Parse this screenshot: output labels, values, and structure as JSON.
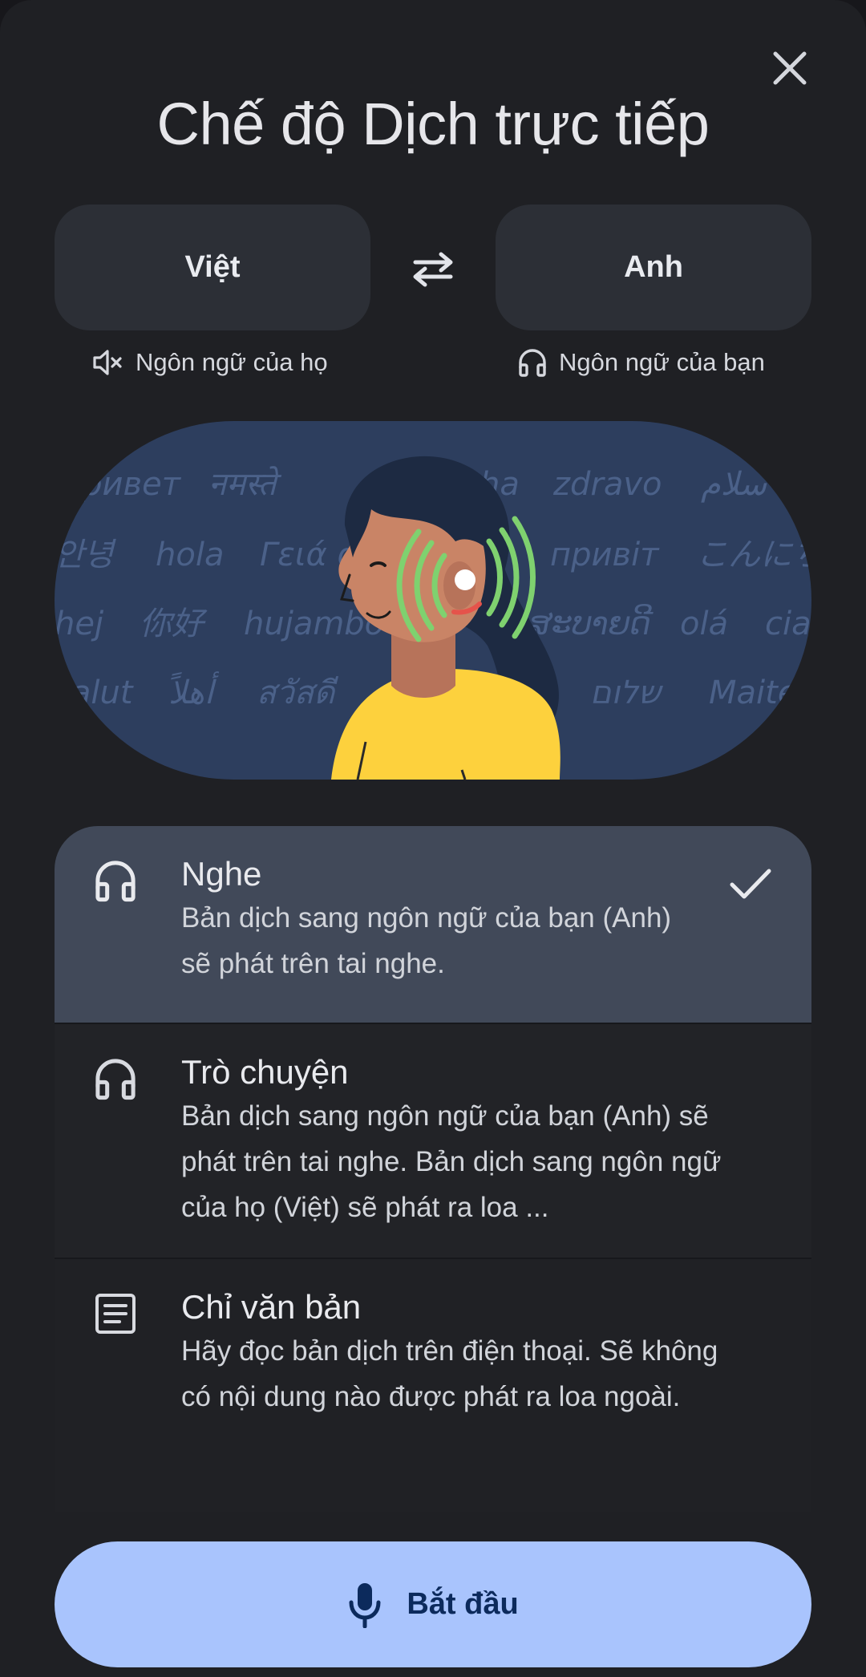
{
  "header": {
    "title": "Chế độ Dịch trực tiếp",
    "close_icon": "close-icon"
  },
  "languages": {
    "source": "Việt",
    "target": "Anh",
    "swap_icon": "swap-icon",
    "source_caption": "Ngôn ngữ của họ",
    "target_caption": "Ngôn ngữ của bạn"
  },
  "hero_words": [
    "привет",
    "नमस्ते",
    "ha",
    "zdravo",
    "سلام",
    "안녕",
    "hola",
    "Γειά σ",
    "привіт",
    "こんにち",
    "hej",
    "你好",
    "hujambo",
    "ສະບາຍດີ",
    "olá",
    "cia",
    "salut",
    "أهلاً",
    "สวัสดี",
    "שלום",
    "Maite"
  ],
  "options": [
    {
      "title": "Nghe",
      "description": "Bản dịch sang ngôn ngữ của bạn (Anh) sẽ phát trên tai nghe.",
      "selected": true
    },
    {
      "title": "Trò chuyện",
      "description": "Bản dịch sang ngôn ngữ của bạn (Anh) sẽ phát trên tai nghe. Bản dịch sang ngôn ngữ của họ (Việt) sẽ phát ra loa ...",
      "selected": false
    },
    {
      "title": "Chỉ văn bản",
      "description": "Hãy đọc bản dịch trên điện thoại. Sẽ không có nội dung nào được phát ra loa ngoài.",
      "selected": false
    }
  ],
  "start_button": {
    "label": "Bắt đầu",
    "icon": "mic-icon"
  },
  "colors": {
    "background": "#1f2024",
    "selected_option": "#414959",
    "start_button": "#a9c4fd",
    "hero_bg": "#2d3e5e"
  }
}
